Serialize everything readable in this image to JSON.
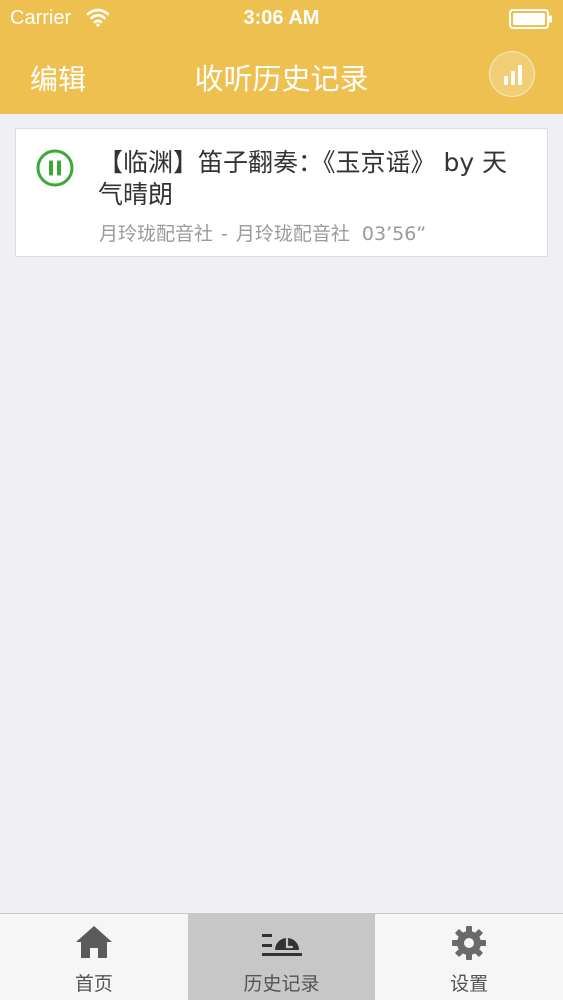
{
  "status_bar": {
    "carrier": "Carrier",
    "time": "3:06 AM"
  },
  "nav": {
    "edit_label": "编辑",
    "title": "收听历史记录",
    "stats_icon": "bar-chart-icon"
  },
  "history": {
    "items": [
      {
        "title": "【临渊】笛子翻奏：《玉京谣》 by 天气晴朗",
        "artist": "月玲珑配音社",
        "album": "月玲珑配音社",
        "separator": "-",
        "duration": "03’56”",
        "state": "playing"
      }
    ]
  },
  "tabs": [
    {
      "label": "首页",
      "icon": "home-icon",
      "active": false
    },
    {
      "label": "历史记录",
      "icon": "history-icon",
      "active": true
    },
    {
      "label": "设置",
      "icon": "gear-icon",
      "active": false
    }
  ],
  "colors": {
    "header": "#eec050",
    "background": "#efeff4",
    "play_accent": "#3aa935",
    "active_tab": "#c7c7c7"
  }
}
